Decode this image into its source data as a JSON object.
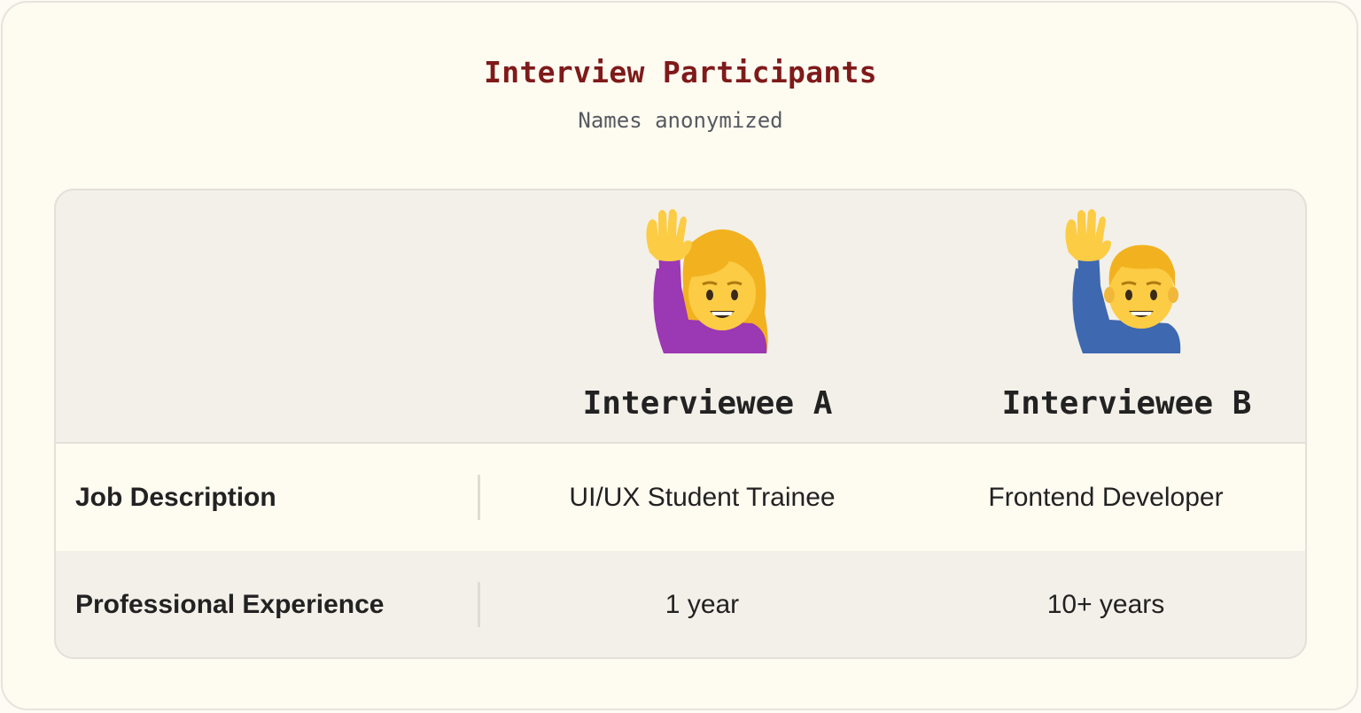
{
  "header": {
    "title": "Interview Participants",
    "subtitle": "Names anonymized"
  },
  "participants": [
    {
      "name": "Interviewee A",
      "avatar": "woman-raising-hand-icon"
    },
    {
      "name": "Interviewee B",
      "avatar": "man-raising-hand-icon"
    }
  ],
  "rows": [
    {
      "label": "Job Description",
      "values": [
        "UI/UX Student Trainee",
        "Frontend Developer"
      ]
    },
    {
      "label": "Professional Experience",
      "values": [
        "1 year",
        "10+ years"
      ]
    }
  ],
  "colors": {
    "title": "#7f1a1a",
    "background": "#fefbf1",
    "table_bg": "#f2f0e9",
    "woman_shirt": "#9b38b3",
    "man_shirt": "#3e68b0",
    "skin": "#fccc45"
  }
}
